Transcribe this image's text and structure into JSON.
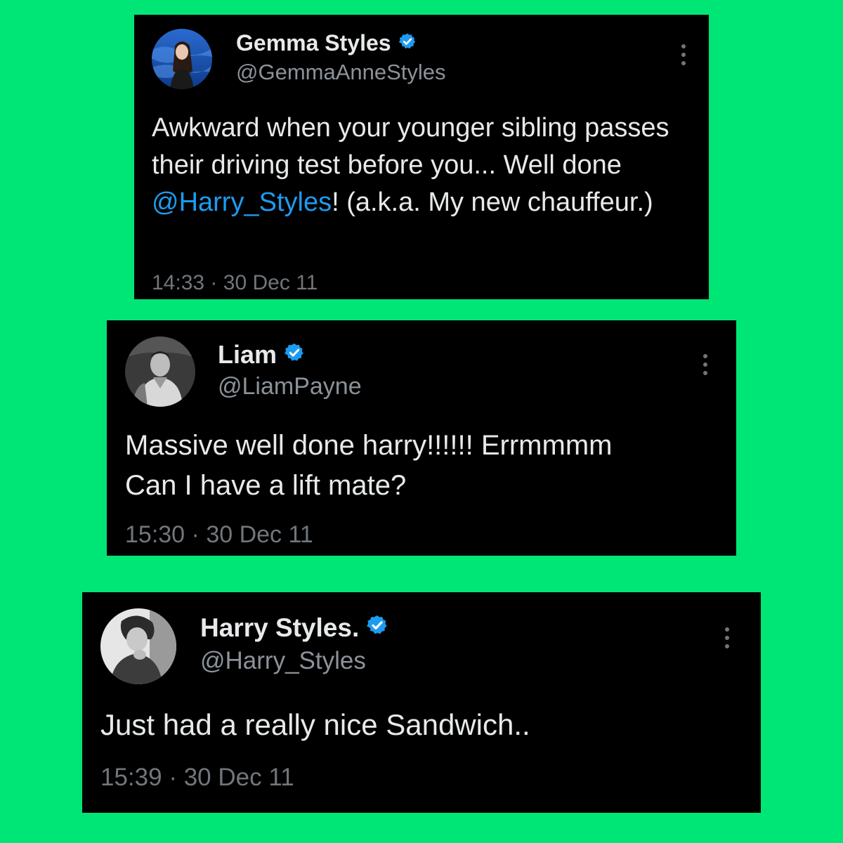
{
  "colors": {
    "background": "#00e676",
    "card": "#000000",
    "text": "#e7e9ea",
    "secondary": "#71767b",
    "link": "#1d9bf0",
    "verified": "#1d9bf0"
  },
  "tweets": [
    {
      "name": "Gemma Styles",
      "handle": "@GemmaAnneStyles",
      "text_before": "Awkward when your younger sibling passes their driving test before you... Well done ",
      "mention": "@Harry_Styles",
      "text_after": "! (a.k.a. My new chauffeur.)",
      "time": "14:33",
      "separator": "·",
      "date": "30 Dec 11",
      "icons": {
        "avatar": "avatar-photo",
        "verified": "verified-badge-icon",
        "more": "more-options-icon"
      }
    },
    {
      "name": "Liam",
      "handle": "@LiamPayne",
      "text_line1": "Massive well done harry!!!!!! Errmmmm",
      "text_line2": "Can I have a lift mate?",
      "time": "15:30",
      "separator": "·",
      "date": "30 Dec 11",
      "icons": {
        "avatar": "avatar-photo",
        "verified": "verified-badge-icon",
        "more": "more-options-icon"
      }
    },
    {
      "name": "Harry Styles.",
      "handle": "@Harry_Styles",
      "text": "Just had a really nice Sandwich..",
      "time": "15:39",
      "separator": "·",
      "date": "30 Dec 11",
      "icons": {
        "avatar": "avatar-photo",
        "verified": "verified-badge-icon",
        "more": "more-options-icon"
      }
    }
  ]
}
